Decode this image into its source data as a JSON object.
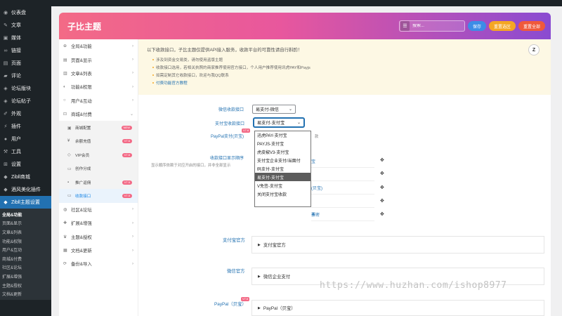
{
  "admin_bar": {
    "items": [
      "",
      "",
      "",
      "",
      "",
      ""
    ],
    "right": ""
  },
  "wp_menu": [
    {
      "label": "仪表盘",
      "icon": "dashboard-icon"
    },
    {
      "label": "文章",
      "icon": "pin-icon"
    },
    {
      "label": "媒体",
      "icon": "media-icon"
    },
    {
      "label": "链接",
      "icon": "link-icon"
    },
    {
      "label": "页面",
      "icon": "page-icon"
    },
    {
      "label": "评论",
      "icon": "comment-icon"
    },
    {
      "label": "论坛版块",
      "icon": "forum-icon"
    },
    {
      "label": "论坛帖子",
      "icon": "forum-post-icon"
    },
    {
      "label": "外观",
      "icon": "brush-icon"
    },
    {
      "label": "插件",
      "icon": "plugin-icon"
    },
    {
      "label": "用户",
      "icon": "user-icon"
    },
    {
      "label": "工具",
      "icon": "wrench-icon"
    },
    {
      "label": "设置",
      "icon": "settings-icon"
    },
    {
      "label": "Zibll商城",
      "icon": "shop-icon"
    },
    {
      "label": "酒风美化插件",
      "icon": "plugin2-icon"
    },
    {
      "label": "Zibll主题设置",
      "icon": "theme-icon"
    }
  ],
  "wp_submenu": [
    "全局&功能",
    "页面&显示",
    "文章&列表",
    "功能&权限",
    "用户&互动",
    "商城&付费",
    "社区&论坛",
    "扩展&增强",
    "主题&授权",
    "文档&更新"
  ],
  "header": {
    "title": "子比主题",
    "search_placeholder": "搜索...",
    "save_label": "保存",
    "reset_selection_label": "重置选区",
    "reset_all_label": "重置全部",
    "colors": {
      "gradient_start": "#f36a86",
      "gradient_end": "#8a4bd1"
    }
  },
  "nav": [
    {
      "label": "全局&功能",
      "icon": "globe-icon",
      "sub": false
    },
    {
      "label": "页面&显示",
      "icon": "layout-icon",
      "sub": false
    },
    {
      "label": "文章&列表",
      "icon": "book-icon",
      "sub": false
    },
    {
      "label": "功能&权限",
      "icon": "shield-icon",
      "sub": false
    },
    {
      "label": "用户&互动",
      "icon": "user-icon",
      "sub": false
    },
    {
      "label": "商城&付费",
      "icon": "cart-icon",
      "sub": false
    },
    {
      "label": "商城配置",
      "icon": "box-icon",
      "sub": true,
      "badge": "NEW"
    },
    {
      "label": "余额充值",
      "icon": "yen-icon",
      "sub": true,
      "badge": "V7.6"
    },
    {
      "label": "VIP会员",
      "icon": "diamond-icon",
      "sub": true,
      "badge": "V7.6"
    },
    {
      "label": "创作分成",
      "icon": "share-icon",
      "sub": true
    },
    {
      "label": "推广返佣",
      "icon": "promo-icon",
      "sub": true,
      "badge": "V7.5"
    },
    {
      "label": "收款接口",
      "icon": "pay-icon",
      "sub": true,
      "badge": "V7.5",
      "current": true
    },
    {
      "label": "社区&论坛",
      "icon": "community-icon",
      "sub": false
    },
    {
      "label": "扩展&增强",
      "icon": "puzzle-icon",
      "sub": false
    },
    {
      "label": "主题&授权",
      "icon": "crown-icon",
      "sub": false
    },
    {
      "label": "文档&更新",
      "icon": "doc-icon",
      "sub": false
    },
    {
      "label": "备份&导入",
      "icon": "backup-icon",
      "sub": false
    }
  ],
  "notice": {
    "heading": "以下收款接口，子比主题仅提供API接入服务，收款平台的可靠性请自行斟酌！",
    "items": [
      "涉及到资金交易类，请勿使用盗版主题",
      "收款接口选用，若相关执照的商家推荐使用官方接口，个人用户推荐使用讯虎PAY和Payjs",
      "如需定制其它收款接口，欢迎与我QQ联系",
      "付费功能官方教程"
    ],
    "logo": "Z"
  },
  "form": {
    "wechat_label": "微信收款接口",
    "wechat_value": "易支付-微信",
    "alipay_label": "支付宝收款接口",
    "alipay_value": "易支付-支付宝",
    "paypal_label": "PayPal支付(贝宝)",
    "paypal_suffix": "款",
    "order_label": "收款接口显示顺序",
    "order_desc": "显示顺序依赖于对应开启的接口，并非全部显示",
    "vip_badge": "V7.6"
  },
  "dropdown_options": [
    {
      "label": "迅虎PAY-支付宝",
      "highlighted": false
    },
    {
      "label": "PAYJS-支付宝",
      "highlighted": false
    },
    {
      "label": "虎皮椒V3-支付宝",
      "highlighted": false
    },
    {
      "label": "支付宝企业支付/当面付",
      "highlighted": false
    },
    {
      "label": "码支付-支付宝",
      "highlighted": false
    },
    {
      "label": "易支付-支付宝",
      "highlighted": true
    },
    {
      "label": "V免签-支付宝",
      "highlighted": false
    },
    {
      "label": "关闭支付宝收款",
      "highlighted": false
    }
  ],
  "order_rows": [
    "宝",
    "",
    "(贝宝)",
    "",
    "票",
    "卡密"
  ],
  "sections": [
    {
      "label": "支付宝官方",
      "accordion": "支付宝官方"
    },
    {
      "label": "微信官方",
      "accordion": "微信企业支付"
    },
    {
      "label": "PayPal（贝宝）",
      "accordion": "PayPal（贝宝）"
    }
  ],
  "watermark": "https://www.huzhan.com/ishop8977"
}
